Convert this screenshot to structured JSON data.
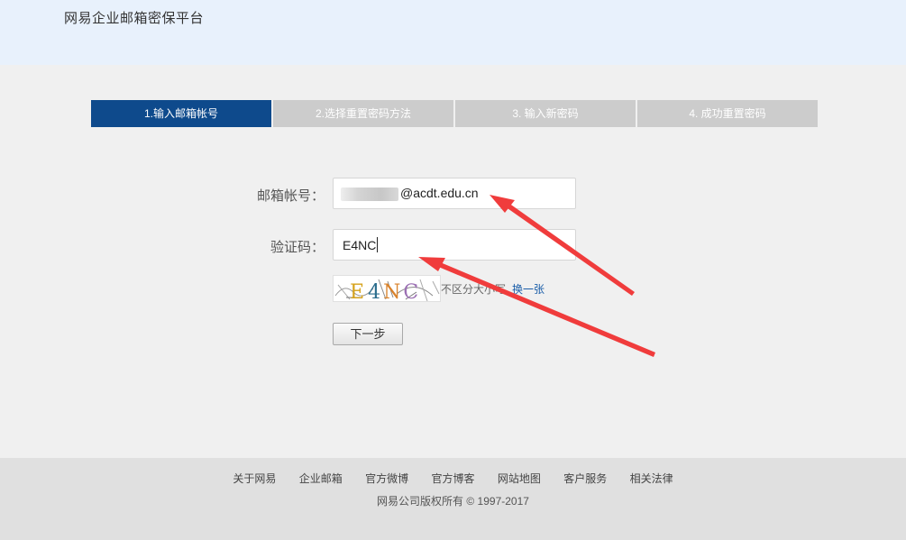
{
  "header": {
    "title": "网易企业邮箱密保平台"
  },
  "steps": [
    {
      "label": "1.输入邮箱帐号",
      "active": true
    },
    {
      "label": "2.选择重置密码方法",
      "active": false
    },
    {
      "label": "3. 输入新密码",
      "active": false
    },
    {
      "label": "4. 成功重置密码",
      "active": false
    }
  ],
  "form": {
    "email_label": "邮箱帐号：",
    "email_domain": "@acdt.edu.cn",
    "captcha_label": "验证码：",
    "captcha_value": "E4NC",
    "captcha_image_text": "E4NC",
    "captcha_hint": "不区分大小写",
    "captcha_refresh": "换一张",
    "next_button": "下一步"
  },
  "footer": {
    "links": [
      "关于网易",
      "企业邮箱",
      "官方微博",
      "官方博客",
      "网站地图",
      "客户服务",
      "相关法律"
    ],
    "copyright": "网易公司版权所有 © 1997-2017"
  },
  "colors": {
    "header_bg": "#e8f1fc",
    "step_active": "#0e4a8c",
    "step_inactive": "#cccccc",
    "link": "#1b5ea9",
    "annotation_arrow": "#f03c3c"
  }
}
